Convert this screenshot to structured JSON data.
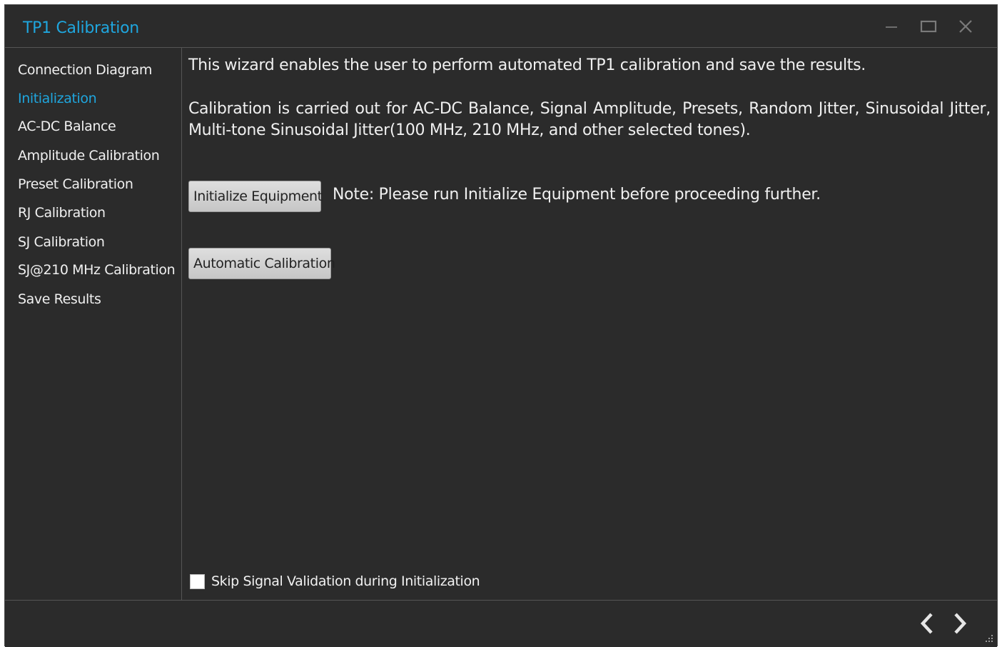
{
  "window": {
    "title": "TP1 Calibration",
    "accent_color": "#1fa6de",
    "background_color": "#2b2b2b",
    "controls": [
      "minimize-icon",
      "maximize-icon",
      "close-icon"
    ]
  },
  "sidebar": {
    "active_index": 1,
    "items": [
      {
        "label": "Connection Diagram"
      },
      {
        "label": "Initialization"
      },
      {
        "label": "AC-DC Balance"
      },
      {
        "label": "Amplitude Calibration"
      },
      {
        "label": "Preset Calibration"
      },
      {
        "label": "RJ Calibration"
      },
      {
        "label": "SJ Calibration"
      },
      {
        "label": "SJ@210 MHz Calibration"
      },
      {
        "label": "Save Results"
      }
    ]
  },
  "main": {
    "intro": "This wizard enables the user to perform automated TP1 calibration and save the results.",
    "description": "Calibration is carried out for AC-DC Balance, Signal Amplitude, Presets, Random Jitter, Sinusoidal Jitter, Multi-tone Sinusoidal Jitter(100 MHz, 210 MHz, and other selected tones).",
    "initialize_button": "Initialize Equipment",
    "note": "Note: Please run Initialize Equipment before proceeding further.",
    "automatic_button": "Automatic Calibration",
    "skip_validation": {
      "label": "Skip Signal Validation during Initialization",
      "checked": false
    }
  },
  "footer": {
    "icons": [
      "chevron-left-icon",
      "chevron-right-icon",
      "resize-grip-icon"
    ]
  }
}
